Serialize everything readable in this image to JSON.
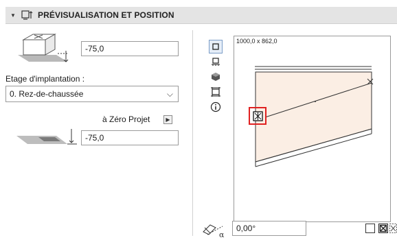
{
  "header": {
    "title": "PRÉVISUALISATION ET POSITION",
    "icon": "preview-position-icon"
  },
  "top_offset": {
    "value": "-75,0"
  },
  "story": {
    "label": "Etage d'implantation :",
    "selected": "0. Rez-de-chaussée"
  },
  "project_zero": {
    "label": "à Zéro Projet",
    "value": "-75,0"
  },
  "preview": {
    "dimensions": "1000,0 x 862,0"
  },
  "rotation": {
    "value": "0,00°"
  },
  "colors": {
    "accent_red": "#e02020",
    "fill_peach": "#fbeee4"
  }
}
